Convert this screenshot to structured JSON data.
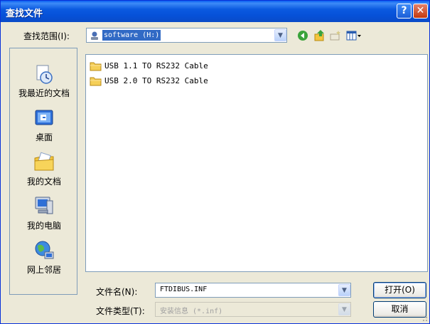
{
  "window": {
    "title": "查找文件"
  },
  "title_buttons": {
    "help": "?",
    "close": "✕"
  },
  "lookin": {
    "label": "查找范围(I):",
    "value": "software (H:)"
  },
  "toolbar": {
    "icons": [
      "back-icon",
      "up-folder-icon",
      "new-folder-icon",
      "view-menu-icon"
    ]
  },
  "places": [
    {
      "label": "我最近的文档",
      "icon": "recent-documents-icon"
    },
    {
      "label": "桌面",
      "icon": "desktop-icon"
    },
    {
      "label": "我的文档",
      "icon": "my-documents-icon"
    },
    {
      "label": "我的电脑",
      "icon": "my-computer-icon"
    },
    {
      "label": "网上邻居",
      "icon": "network-places-icon"
    }
  ],
  "files": [
    {
      "name": "USB 1.1 TO RS232 Cable",
      "icon": "folder-icon"
    },
    {
      "name": "USB 2.0 TO RS232 Cable",
      "icon": "folder-icon"
    }
  ],
  "filename": {
    "label": "文件名(N):",
    "value": "FTDIBUS.INF"
  },
  "filetype": {
    "label": "文件类型(T):",
    "value": "安装信息 (*.inf)"
  },
  "buttons": {
    "open": "打开(O)",
    "cancel": "取消"
  },
  "colors": {
    "titlebar": "#0a5ff2",
    "selection": "#316ac5",
    "face": "#ece9d8"
  }
}
